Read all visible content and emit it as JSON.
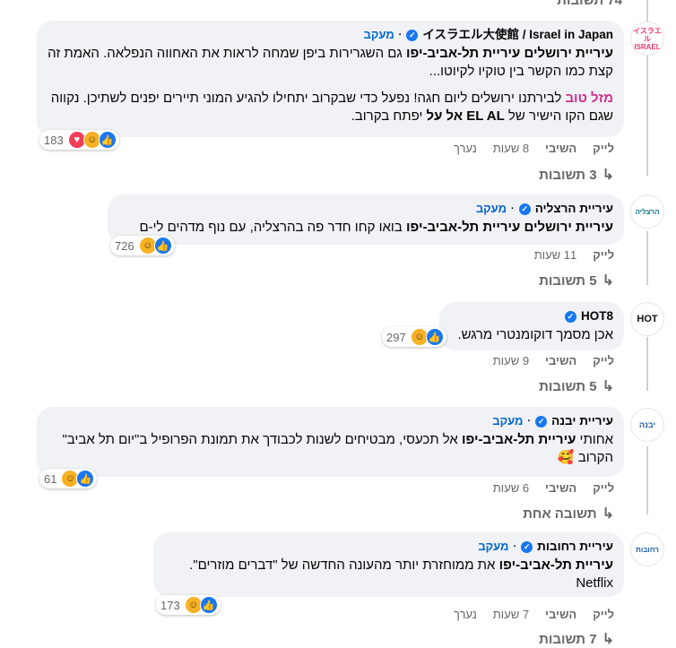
{
  "top_replies": {
    "label": "74 תשובות"
  },
  "comments": [
    {
      "author": "イスラエル大使館 / Israel in Japan",
      "follow": "מעקב",
      "p1_tag1": "עיריית ירושלים",
      "p1_tag2": "עיריית תל-אביב-יפו",
      "p1_rest": " גם השגרירות ביפן שמחה לראות את האחווה הנפלאה. האמת זה קצת כמו הקשר בין טוקיו לקיוטו...",
      "p2_mazal": "מזל טוב",
      "p2_rest1": " לבירתנו ירושלים ליום חגה! נפעל כדי שבקרוב יתחילו להגיע המוני תיירים יפנים לשתיכן. נקווה שגם הקו הישיר של ",
      "p2_elal": "EL AL אל על",
      "p2_rest2": " יפתח בקרוב.",
      "reactions": "183",
      "like": "לייק",
      "reply": "השיבי",
      "time": "8 שעות",
      "edited": "נערך",
      "replies": "3 תשובות"
    },
    {
      "author": "עיריית הרצליה",
      "follow": "מעקב",
      "tag1": "עיריית ירושלים",
      "tag2": "עיריית תל-אביב-יפו",
      "rest": " בואו קחו חדר פה בהרצליה, עם נוף מדהים לי-ם",
      "reactions": "726",
      "like": "לייק",
      "time": "11 שעות",
      "replies": "5 תשובות"
    },
    {
      "author": "HOT8",
      "text": "אכן מסמך דוקומנטרי מרגש.",
      "reactions": "297",
      "like": "לייק",
      "reply": "השיבי",
      "time": "9 שעות",
      "replies": "5 תשובות"
    },
    {
      "author": "עיריית יבנה",
      "follow": "מעקב",
      "pre": "אחותי ",
      "tag": "עיריית תל-אביב-יפו",
      "rest": " אל תכעסי, מבטיחים לשנות לכבודך את תמונת הפרופיל ב\"יום תל אביב\" הקרוב",
      "reactions": "61",
      "like": "לייק",
      "reply": "השיבי",
      "time": "6 שעות",
      "replies": "תשובה אחת"
    },
    {
      "author": "עיריית רחובות",
      "follow": "מעקב",
      "tag": "עיריית תל-אביב-יפו",
      "rest": " את ממוחזרת יותר מהעונה החדשה של \"דברים מוזרים\". Netflix",
      "reactions": "173",
      "like": "לייק",
      "reply": "השיבי",
      "time": "7 שעות",
      "edited": "נערך",
      "replies": "7 תשובות"
    }
  ],
  "avatars": {
    "israel_japan": "イスラエル ISRAEL",
    "herzliya": "הרצליה",
    "hot8": "HOT",
    "yavne": "יבנה",
    "rehovot": "רחובות"
  }
}
